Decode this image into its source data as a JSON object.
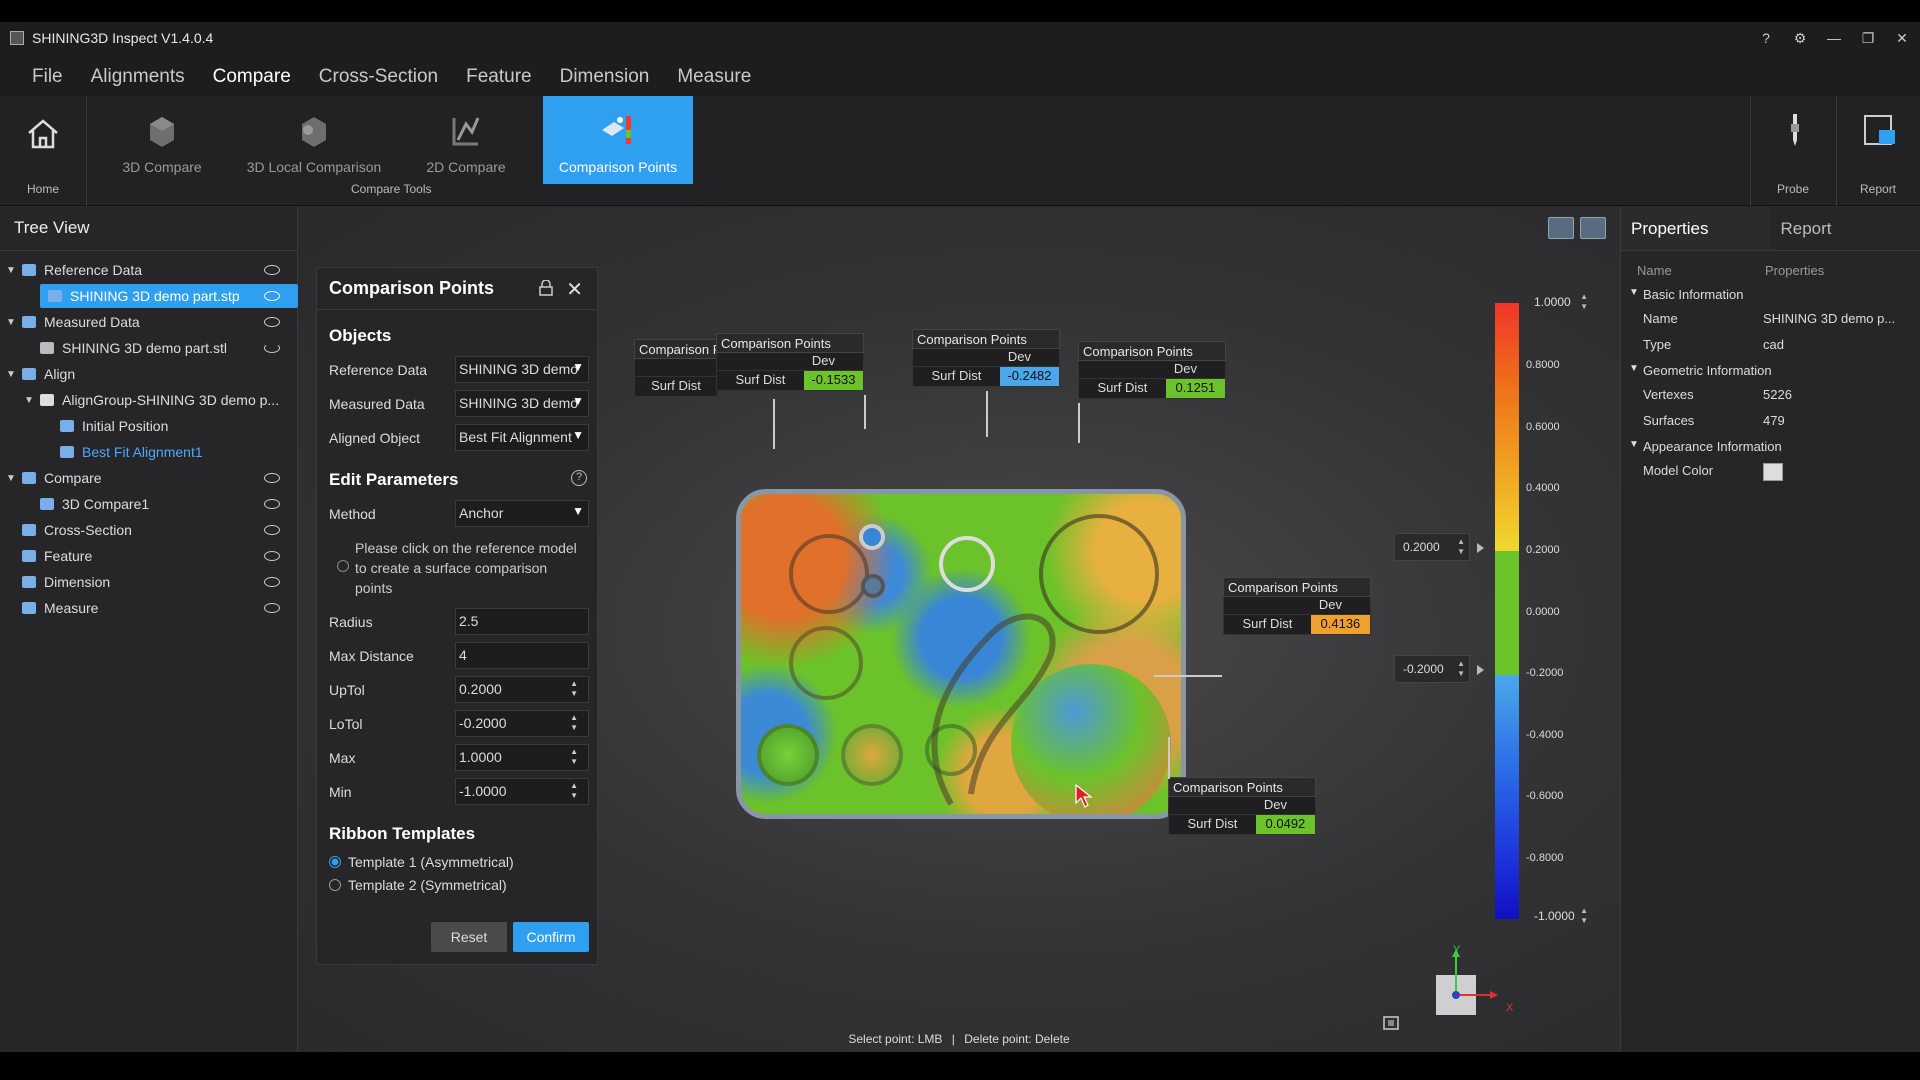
{
  "app": {
    "title": "SHINING3D Inspect V1.4.0.4"
  },
  "menu": [
    "File",
    "Alignments",
    "Compare",
    "Cross-Section",
    "Feature",
    "Dimension",
    "Measure"
  ],
  "ribbon": {
    "home_label": "Home",
    "tools": [
      "3D Compare",
      "3D Local Comparison",
      "2D Compare",
      "Comparison Points"
    ],
    "group_label": "Compare Tools",
    "probe_label": "Probe",
    "report_label": "Report"
  },
  "tree": {
    "title": "Tree View",
    "items": [
      "Reference Data",
      "SHINING 3D demo part.stp",
      "Measured Data",
      "SHINING 3D demo part.stl",
      "Align",
      "AlignGroup-SHINING 3D demo p...",
      "Initial Position",
      "Best Fit Alignment1",
      "Compare",
      "3D Compare1",
      "Cross-Section",
      "Feature",
      "Dimension",
      "Measure"
    ]
  },
  "dialog": {
    "title": "Comparison Points",
    "objects_title": "Objects",
    "reference_label": "Reference Data",
    "reference_value": "SHINING 3D demo",
    "measured_label": "Measured Data",
    "measured_value": "SHINING 3D demo",
    "aligned_label": "Aligned Object",
    "aligned_value": "Best Fit Alignment",
    "edit_title": "Edit Parameters",
    "method_label": "Method",
    "method_value": "Anchor",
    "hint": "Please click on the reference model to create a surface comparison points",
    "radius_label": "Radius",
    "radius_value": "2.5",
    "maxdist_label": "Max Distance",
    "maxdist_value": "4",
    "uptol_label": "UpTol",
    "uptol_value": "0.2000",
    "lotol_label": "LoTol",
    "lotol_value": "-0.2000",
    "max_label": "Max",
    "max_value": "1.0000",
    "min_label": "Min",
    "min_value": "-1.0000",
    "ribbon_title": "Ribbon Templates",
    "template1": "Template 1 (Asymmetrical)",
    "template2": "Template 2 (Symmetrical)",
    "reset": "Reset",
    "confirm": "Confirm"
  },
  "annotations": {
    "title": "Comparison Points",
    "title_cut": "Comparison F",
    "dev": "Dev",
    "surf": "Surf Dist",
    "values": [
      "-0.1533",
      "-0.2482",
      "0.1251",
      "0.4136",
      "0.0492"
    ],
    "value_colors": [
      "#6cc22a",
      "#4aa8ea",
      "#6cc22a",
      "#f0a030",
      "#6cc22a"
    ]
  },
  "colorbar": {
    "ticks": [
      "0.8000",
      "0.6000",
      "0.4000",
      "0.2000",
      "0.0000",
      "-0.2000",
      "-0.4000",
      "-0.6000",
      "-0.8000"
    ],
    "top_value": "1.0000",
    "bottom_value": "-1.0000",
    "uptol_value": "0.2000",
    "lotol_value": "-0.2000"
  },
  "axes": {
    "y": "Y",
    "x": "X"
  },
  "status": {
    "select": "Select point: LMB",
    "delete": "Delete point: Delete",
    "sep": "|"
  },
  "properties": {
    "tabs": [
      "Properties",
      "Report"
    ],
    "col_name": "Name",
    "col_props": "Properties",
    "basic": "Basic Information",
    "name_label": "Name",
    "name_value": "SHINING 3D demo p...",
    "type_label": "Type",
    "type_value": "cad",
    "geom": "Geometric Information",
    "vertexes_label": "Vertexes",
    "vertexes_value": "5226",
    "surfaces_label": "Surfaces",
    "surfaces_value": "479",
    "appearance": "Appearance Information",
    "color_label": "Model Color"
  }
}
